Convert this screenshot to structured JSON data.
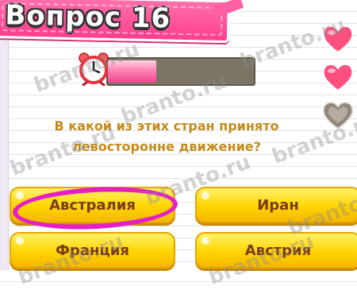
{
  "header": {
    "title": "Вопрос 16"
  },
  "timer": {
    "progress": 0.33
  },
  "lives": [
    {
      "state": "full",
      "color": "#ff4f7f"
    },
    {
      "state": "full",
      "color": "#ff4f7f"
    },
    {
      "state": "empty",
      "color": "#8f877c"
    }
  ],
  "question": {
    "line1": "В какой из этих стран принято",
    "line2": "левосторонне движение?"
  },
  "answers": [
    {
      "label": "Австралия",
      "selected": true
    },
    {
      "label": "Иран",
      "selected": false
    },
    {
      "label": "Франция",
      "selected": false
    },
    {
      "label": "Австрия",
      "selected": false
    }
  ],
  "watermark": {
    "text": "branto.ru"
  },
  "colors": {
    "header": "#ff4f9a",
    "answer": "#ffd400",
    "question_text": "#c58a1b",
    "highlight": "#e51ec6"
  },
  "icons": {
    "timer": "alarm-clock-icon",
    "life": "heart-icon"
  }
}
